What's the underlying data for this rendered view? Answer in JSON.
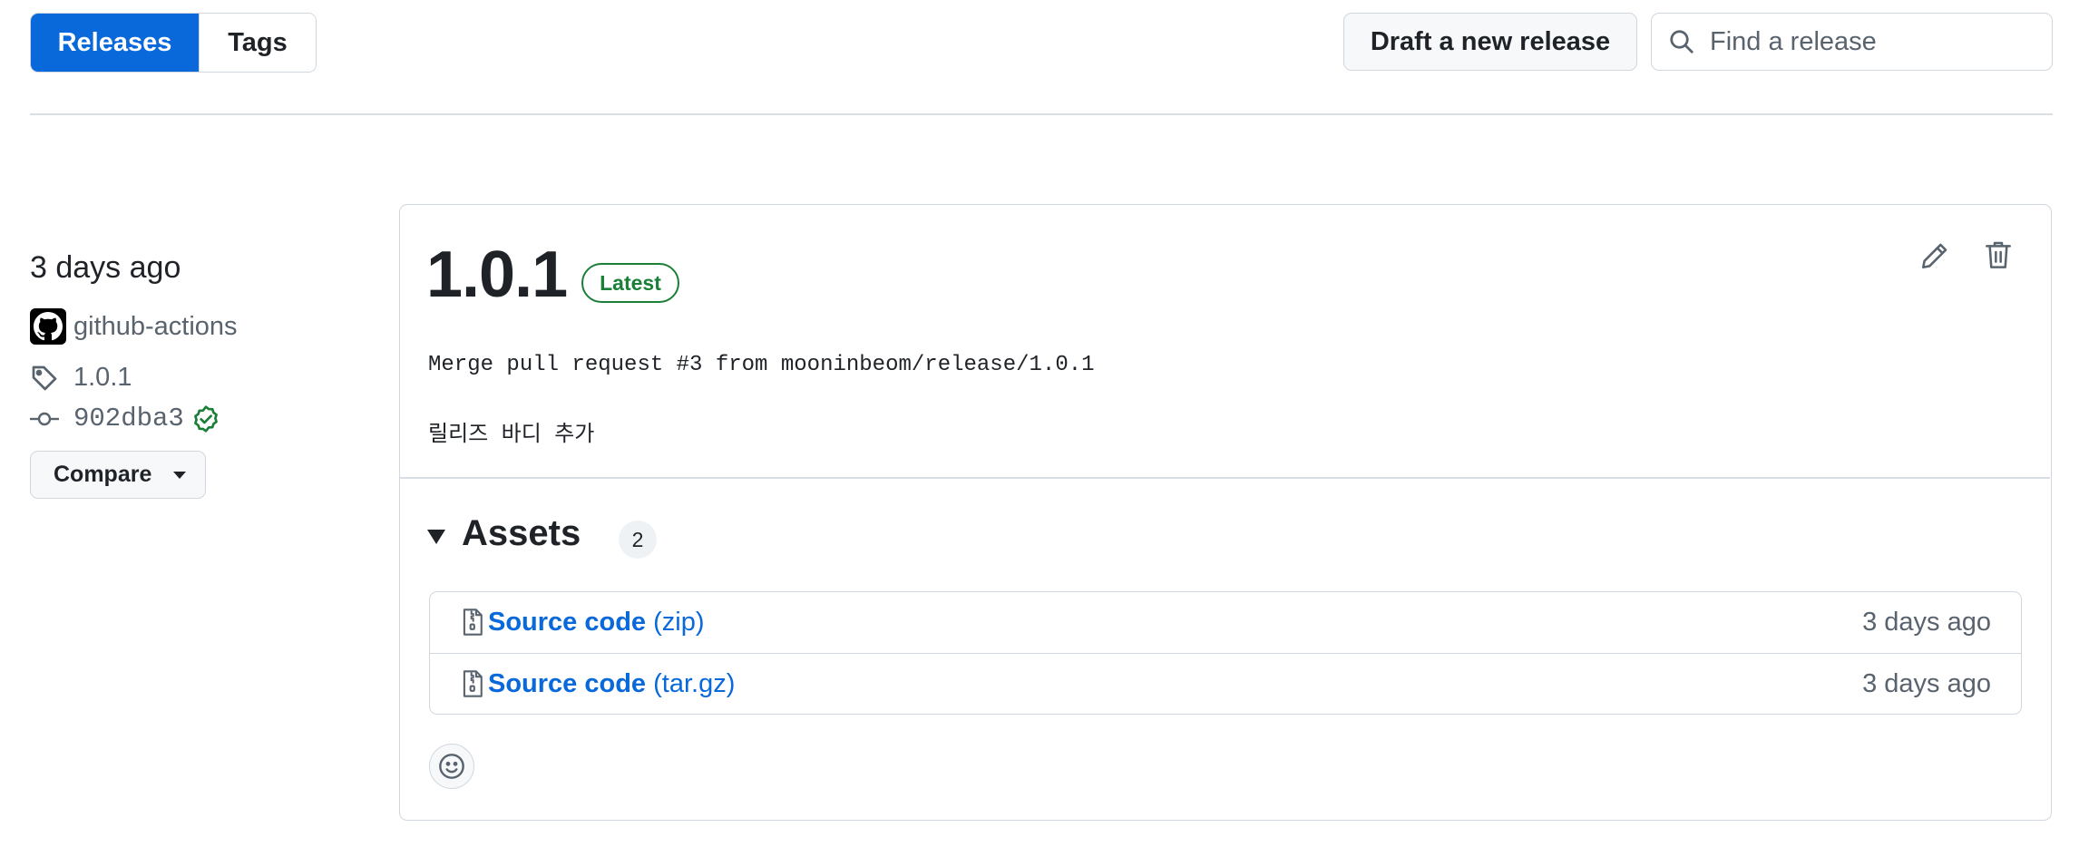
{
  "tabs": [
    {
      "label": "Releases",
      "active": true
    },
    {
      "label": "Tags",
      "active": false
    }
  ],
  "toolbar": {
    "draft_label": "Draft a new release",
    "search_placeholder": "Find a release"
  },
  "release": {
    "when": "3 days ago",
    "author": "github-actions",
    "tag": "1.0.1",
    "commit": "902dba3",
    "compare_label": "Compare",
    "version": "1.0.1",
    "badge": "Latest",
    "body_line1": "Merge pull request #3 from mooninbeom/release/1.0.1",
    "body_line2": "릴리즈 바디 추가",
    "assets": {
      "title": "Assets",
      "count": "2",
      "items": [
        {
          "name": "Source code",
          "ext": "(zip)",
          "date": "3 days ago"
        },
        {
          "name": "Source code",
          "ext": "(tar.gz)",
          "date": "3 days ago"
        }
      ]
    }
  },
  "colors": {
    "accent": "#0969da",
    "success": "#1a7f37",
    "border": "#d0d7de",
    "muted_text": "#59636e"
  },
  "icons": [
    "search-icon",
    "github-logo-icon",
    "tag-icon",
    "git-commit-icon",
    "verified-check-icon",
    "triangle-down-icon",
    "pencil-icon",
    "trash-icon",
    "file-zip-icon",
    "smiley-icon"
  ]
}
